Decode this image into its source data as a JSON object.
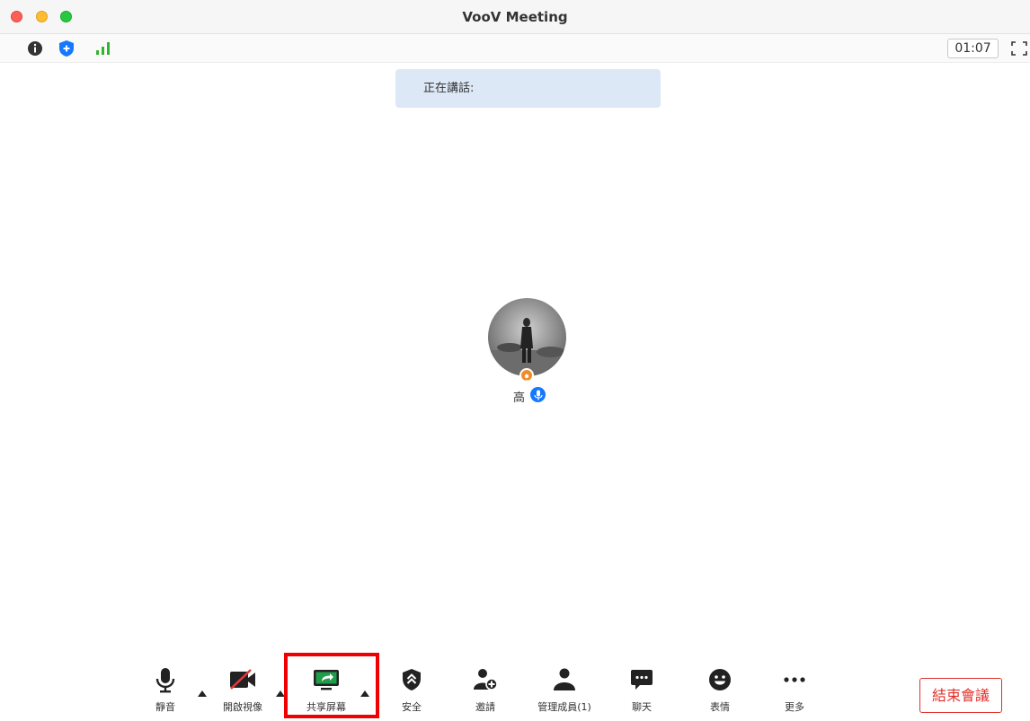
{
  "window": {
    "title": "VooV Meeting"
  },
  "status": {
    "timer": "01:07"
  },
  "banner": {
    "speaking_label": "正在講話:"
  },
  "participant": {
    "name": "高"
  },
  "toolbar": {
    "mute": "靜音",
    "video": "開啟視像",
    "share": "共享屏幕",
    "security": "安全",
    "invite": "邀請",
    "members": "管理成員(1)",
    "chat": "聊天",
    "reactions": "表情",
    "more": "更多",
    "end": "結束會議"
  },
  "colors": {
    "end_red": "#e0302b",
    "highlight_red": "#f00000",
    "accent_blue": "#1677ff",
    "signal_green": "#2fb62f",
    "host_orange": "#f28c28",
    "banner_blue": "#dde8f7"
  },
  "icons": [
    "info-icon",
    "shield-icon",
    "signal-icon",
    "fullscreen-icon",
    "microphone-icon",
    "video-off-icon",
    "share-screen-icon",
    "security-icon",
    "add-user-icon",
    "members-icon",
    "chat-icon",
    "emoji-icon",
    "more-icon"
  ]
}
